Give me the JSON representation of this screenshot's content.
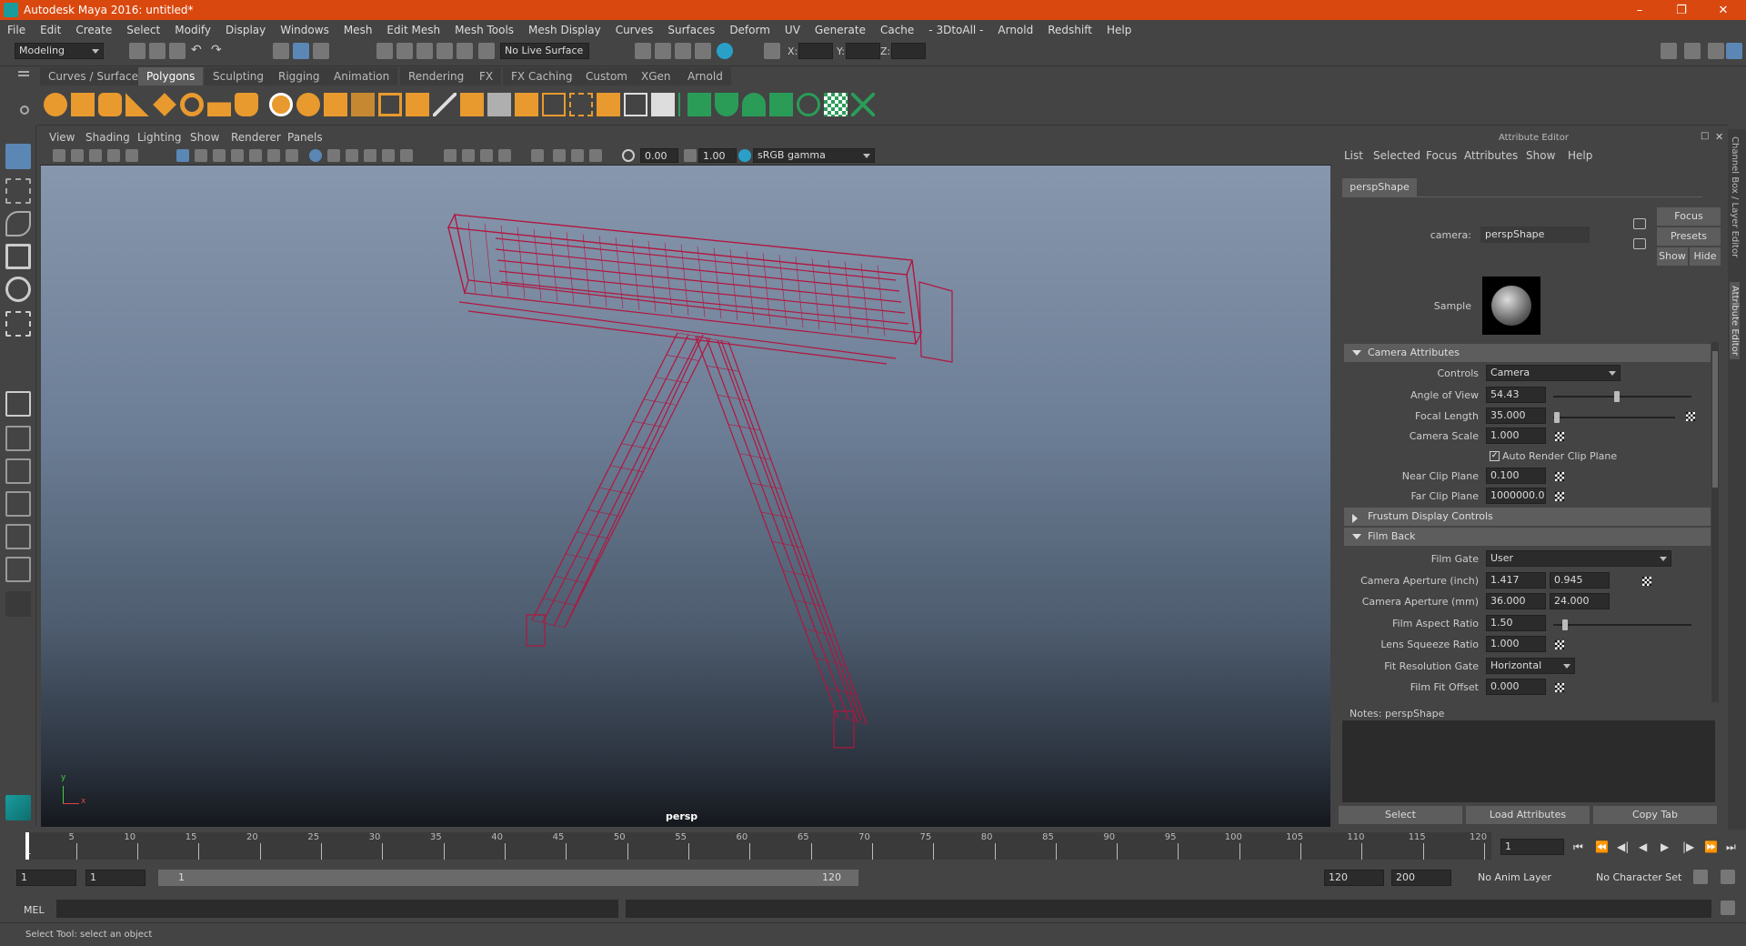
{
  "window": {
    "title": "Autodesk Maya 2016: untitled*"
  },
  "menubar": [
    "File",
    "Edit",
    "Create",
    "Select",
    "Modify",
    "Display",
    "Windows",
    "Mesh",
    "Edit Mesh",
    "Mesh Tools",
    "Mesh Display",
    "Curves",
    "Surfaces",
    "Deform",
    "UV",
    "Generate",
    "Cache",
    "- 3DtoAll -",
    "Arnold",
    "Redshift",
    "Help"
  ],
  "statusline": {
    "menu_set": "Modeling",
    "live_surface": "No Live Surface",
    "x_label": "X:",
    "y_label": "Y:",
    "z_label": "Z:"
  },
  "shelf_tabs": [
    {
      "label": "Curves / Surfaces"
    },
    {
      "label": "Polygons",
      "active": true
    },
    {
      "label": "Sculpting"
    },
    {
      "label": "Rigging"
    },
    {
      "label": "Animation"
    },
    {
      "label": "Rendering"
    },
    {
      "label": "FX"
    },
    {
      "label": "FX Caching"
    },
    {
      "label": "Custom"
    },
    {
      "label": "XGen"
    },
    {
      "label": "Arnold"
    }
  ],
  "viewport": {
    "menu": [
      "View",
      "Shading",
      "Lighting",
      "Show",
      "Renderer",
      "Panels"
    ],
    "exposure": "0.00",
    "gamma": "1.00",
    "color_space": "sRGB gamma",
    "camera_label": "persp",
    "axis_y": "y",
    "axis_x": "x",
    "wire_color": "#b3153f"
  },
  "attribute_editor": {
    "title": "Attribute Editor",
    "menu": [
      "List",
      "Selected",
      "Focus",
      "Attributes",
      "Show",
      "Help"
    ],
    "tab": "perspShape",
    "camera_label": "camera:",
    "camera_value": "perspShape",
    "buttons": {
      "focus": "Focus",
      "presets": "Presets",
      "show": "Show",
      "hide": "Hide"
    },
    "sample_label": "Sample",
    "sections": {
      "camera_attributes": "Camera Attributes",
      "frustum": "Frustum Display Controls",
      "film_back": "Film Back"
    },
    "fields": {
      "controls_label": "Controls",
      "controls_value": "Camera",
      "aov_label": "Angle of View",
      "aov_value": "54.43",
      "aov_level": 0.46,
      "focal_label": "Focal Length",
      "focal_value": "35.000",
      "focal_level": 0.01,
      "scale_label": "Camera Scale",
      "scale_value": "1.000",
      "auto_clip_label": "Auto Render Clip Plane",
      "near_label": "Near Clip Plane",
      "near_value": "0.100",
      "far_label": "Far Clip Plane",
      "far_value": "1000000.000",
      "gate_label": "Film Gate",
      "gate_value": "User",
      "ap_inch_label": "Camera Aperture (inch)",
      "ap_inch_x": "1.417",
      "ap_inch_y": "0.945",
      "ap_mm_label": "Camera Aperture (mm)",
      "ap_mm_x": "36.000",
      "ap_mm_y": "24.000",
      "aspect_label": "Film Aspect Ratio",
      "aspect_value": "1.50",
      "aspect_level": 0.07,
      "squeeze_label": "Lens Squeeze Ratio",
      "squeeze_value": "1.000",
      "fit_label": "Fit Resolution Gate",
      "fit_value": "Horizontal",
      "offset_label": "Film Fit Offset",
      "offset_value": "0.000"
    },
    "notes": "Notes:  perspShape",
    "bottom_buttons": [
      "Select",
      "Load Attributes",
      "Copy Tab"
    ],
    "side_tabs": [
      "Channel Box / Layer Editor",
      "Attribute Editor"
    ]
  },
  "timeline": {
    "ticks": [
      "5",
      "10",
      "15",
      "20",
      "25",
      "30",
      "35",
      "40",
      "45",
      "50",
      "55",
      "60",
      "65",
      "70",
      "75",
      "80",
      "85",
      "90",
      "95",
      "100",
      "105",
      "110",
      "115",
      "120"
    ],
    "current_frame": "1",
    "playhead_frame": "1"
  },
  "range": {
    "start": "1",
    "start2": "1",
    "bar_start": "1",
    "bar_end": "120",
    "end": "120",
    "end2": "200",
    "anim_layer": "No Anim Layer",
    "char_set": "No Character Set"
  },
  "command": {
    "label": "MEL"
  },
  "help_line": "Select Tool: select an object"
}
